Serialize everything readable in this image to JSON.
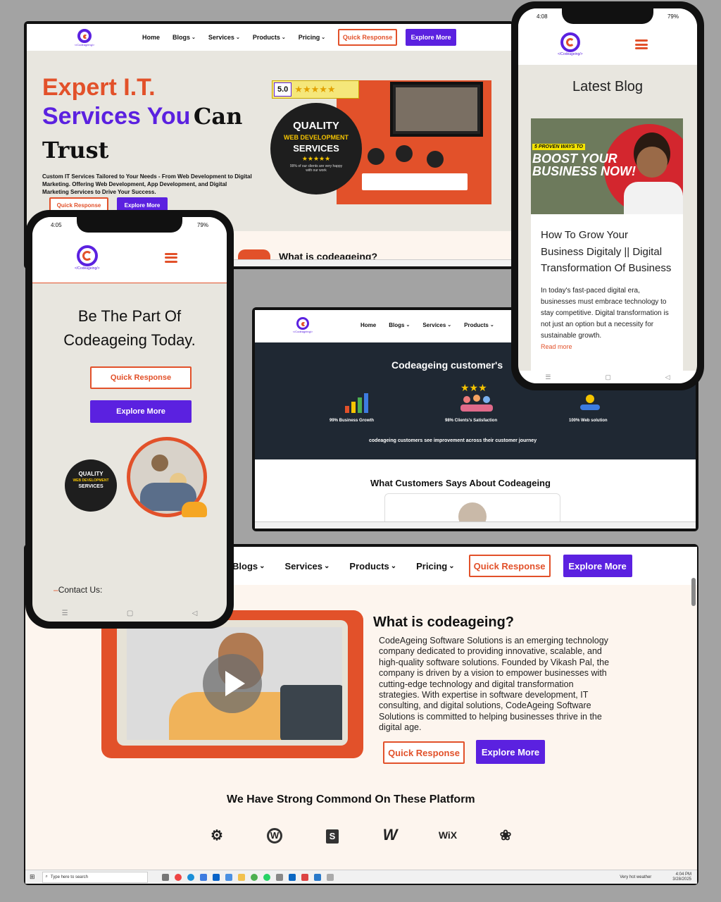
{
  "brand": {
    "logo_text": "</Codeageing/>",
    "primary": "#5b21e0",
    "accent": "#e2512a",
    "bg": "#a3a3a3"
  },
  "nav": {
    "home": "Home",
    "blogs": "Blogs",
    "services": "Services",
    "products": "Products",
    "pricing": "Pricing",
    "quick_response": "Quick Response",
    "explore_more": "Explore More"
  },
  "hero": {
    "title_line1": "Expert I.T.",
    "title_line2a": "Services You",
    "title_line2b": "Can",
    "title_line3": "Trust",
    "subtitle": "Custom IT Services Tailored to Your Needs - From Web Development to Digital Marketing. Offering Web Development, App Development, and Digital Marketing Services to Drive Your Success.",
    "rating": "5.0",
    "stars": "★★★★★",
    "badge_quality": "QUALITY",
    "badge_webdev": "WEB DEVELOPMENT",
    "badge_services": "SERVICES",
    "badge_note": "99% of our clients are very happy with our work",
    "next_heading": "What is codeageing?"
  },
  "phone_left": {
    "time": "4:05",
    "battery": "79%",
    "heading": "Be The Part Of Codeageing Today.",
    "contact": "Contact Us:",
    "badge_quality": "QUALITY",
    "badge_webdev": "WEB DEVELOPMENT",
    "badge_services": "SERVICES"
  },
  "phone_right": {
    "time": "4:08",
    "battery": "79%",
    "heading": "Latest Blog",
    "image_tag": "5 PROVEN WAYS TO",
    "image_headline": "BOOST YOUR BUSINESS NOW!",
    "post_title": "How To Grow Your Business Digitaly || Digital Transformation Of Business",
    "post_excerpt": "In today's fast-paced digital era, businesses must embrace technology to stay competitive. Digital transformation is not just an option but a necessity for sustainable growth.",
    "read_more": "Read more"
  },
  "middle": {
    "banner_title": "Codeageing customer's",
    "stat1": "99% Business Growth",
    "stat2": "98% Clients's Satisfaction",
    "stat3": "100% Web solution",
    "stars": "★★★",
    "banner_footer": "codeageing customers see improvement across their customer journey",
    "testimonials_heading": "What Customers Says About Codeageing"
  },
  "about": {
    "heading": "What is codeageing?",
    "body": "CodeAgeing Software Solutions is an emerging technology company dedicated to providing innovative, scalable, and high-quality software solutions. Founded by Vikash Pal, the company is driven by a vision to empower businesses with cutting-edge technology and digital transformation strategies. With expertise in software development, IT consulting, and digital solutions, CodeAgeing Software Solutions is committed to helping businesses thrive in the digital age.",
    "platforms_heading": "We Have Strong Commond On These Platform",
    "platforms": [
      "HubSpot",
      "WordPress",
      "Shopify",
      "Webflow",
      "WiX",
      "Figma"
    ],
    "wix": "WiX"
  },
  "taskbar": {
    "search": "Type here to search",
    "weather": "Very hot weather",
    "time": "4:04 PM",
    "date": "3/28/2025"
  }
}
